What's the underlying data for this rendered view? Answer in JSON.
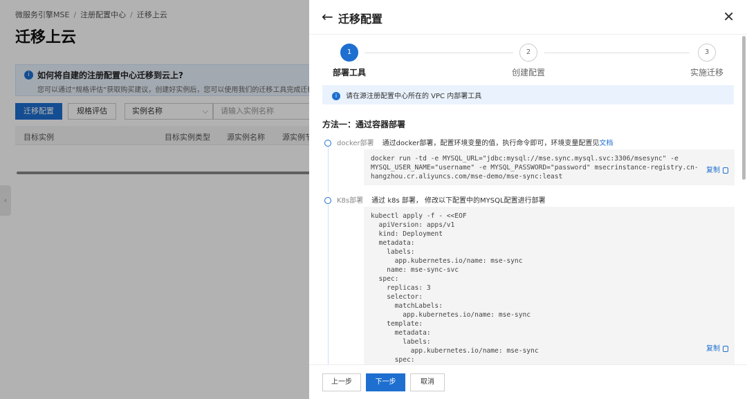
{
  "background": {
    "breadcrumb": [
      "微服务引擎MSE",
      "注册配置中心",
      "迁移上云"
    ],
    "title": "迁移上云",
    "notice": {
      "title": "如何将自建的注册配置中心迁移到云上?",
      "desc": "您可以通过“规格评估”获取购买建议，创建好实例后，您可以使用我们的迁移工具完成迁移"
    },
    "toolbar": {
      "migrate_btn": "迁移配置",
      "evaluate_btn": "规格评估",
      "select_value": "实例名称",
      "search_placeholder": "请输入实例名称"
    },
    "table_headers": [
      "目标实例",
      "目标实例类型",
      "源实例名称",
      "源实例节"
    ]
  },
  "drawer": {
    "title": "迁移配置",
    "steps": [
      {
        "num": "1",
        "label": "部署工具",
        "status": "active"
      },
      {
        "num": "2",
        "label": "创建配置",
        "status": "idle"
      },
      {
        "num": "3",
        "label": "实施迁移",
        "status": "idle"
      }
    ],
    "tip": "请在源注册配置中心所在的 VPC 内部署工具",
    "method_title": "方法一：通过容器部署",
    "docker": {
      "name": "docker部署",
      "desc": "通过docker部署，配置环境变量的值，执行命令即可，环境变量配置见",
      "link": "文档",
      "code": "docker run -td -e MYSQL_URL=\"jdbc:mysql://mse.sync.mysql.svc:3306/msesync\" -e\nMYSQL_USER_NAME=\"username\" -e MYSQL_PASSWORD=\"password\" msecrinstance-registry.cn-\nhangzhou.cr.aliyuncs.com/mse-demo/mse-sync:least",
      "copy": "复制"
    },
    "k8s": {
      "name": "K8s部署",
      "desc": "通过 k8s 部署， 修改以下配置中的MYSQL配置进行部署",
      "code": "kubectl apply -f - <<EOF\n  apiVersion: apps/v1\n  kind: Deployment\n  metadata:\n    labels:\n      app.kubernetes.io/name: mse-sync\n    name: mse-sync-svc\n  spec:\n    replicas: 3\n    selector:\n      matchLabels:\n        app.kubernetes.io/name: mse-sync\n    template:\n      metadata:\n        labels:\n          app.kubernetes.io/name: mse-sync\n      spec:",
      "copy": "复制"
    },
    "footer": {
      "prev": "上一步",
      "next": "下一步",
      "cancel": "取消"
    }
  }
}
